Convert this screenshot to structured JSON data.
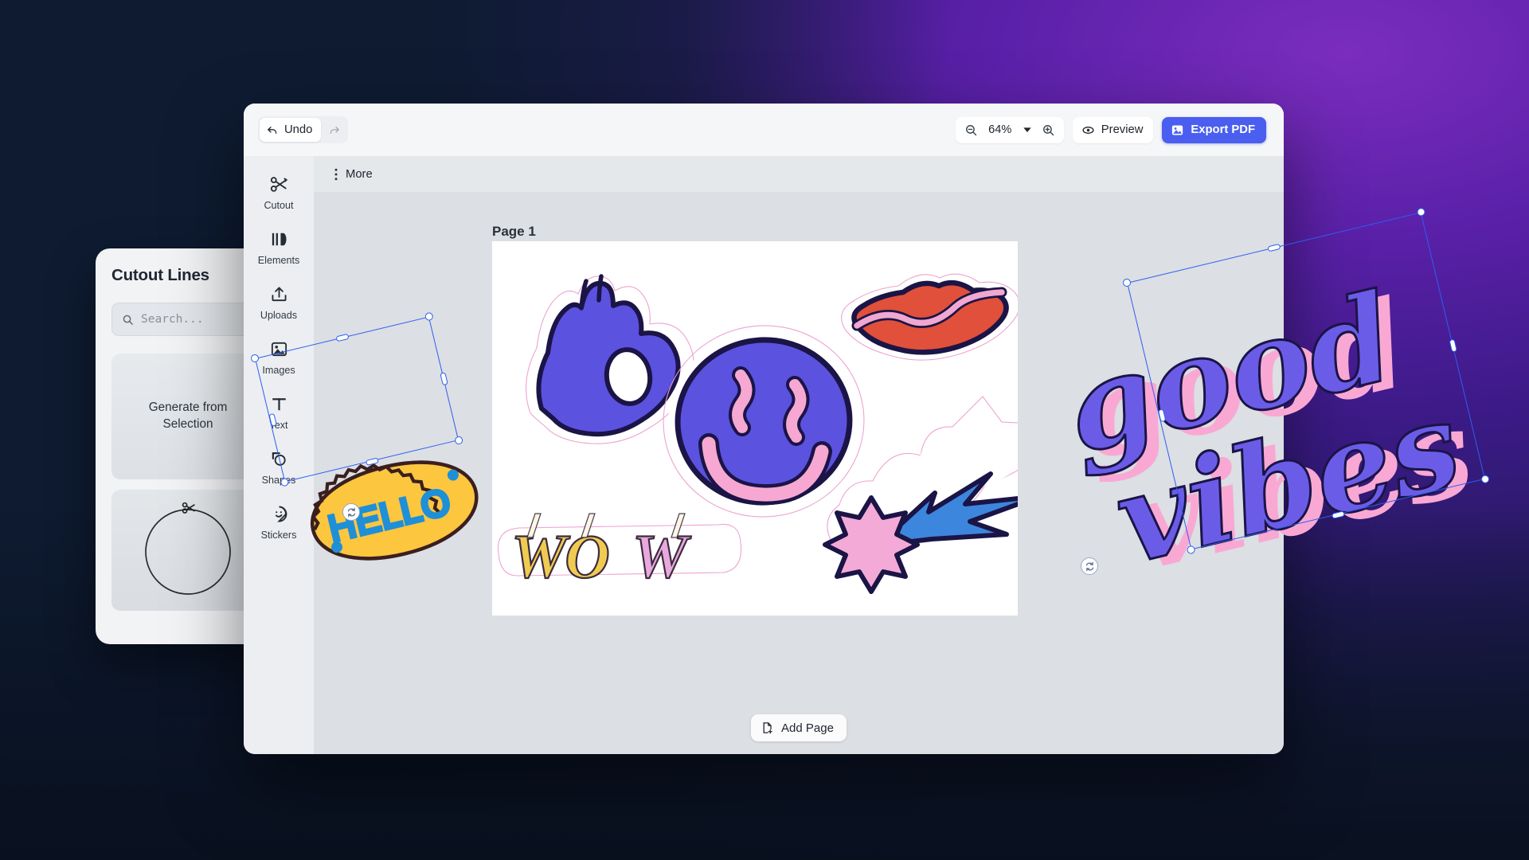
{
  "background": {
    "dark": "#0e1b31",
    "purple": "#5a20a8",
    "magenta": "#7b2dbd"
  },
  "cutout_panel": {
    "title": "Cutout Lines",
    "search_placeholder": "Search...",
    "generate_button": "Generate from Selection",
    "thumbnail_icon": "scissors-circle-icon"
  },
  "toolbar": {
    "undo_label": "Undo",
    "undo_icon": "undo-arrow-icon",
    "redo_icon": "redo-arrow-icon",
    "zoom_out_icon": "zoom-out-icon",
    "zoom_value": "64%",
    "zoom_caret_icon": "chevron-down-icon",
    "zoom_in_icon": "zoom-in-icon",
    "preview_label": "Preview",
    "preview_icon": "eye-icon",
    "export_label": "Export PDF",
    "export_icon": "image-export-icon",
    "accent_color": "#4a5ef0"
  },
  "more_bar": {
    "label": "More",
    "icon": "more-vertical-icon"
  },
  "rail": {
    "items": [
      {
        "label": "Cutout",
        "icon": "scissors-icon"
      },
      {
        "label": "Elements",
        "icon": "elements-icon"
      },
      {
        "label": "Uploads",
        "icon": "upload-icon"
      },
      {
        "label": "Images",
        "icon": "image-icon"
      },
      {
        "label": "Text",
        "icon": "text-t-icon"
      },
      {
        "label": "Shapes",
        "icon": "shapes-icon"
      },
      {
        "label": "Stickers",
        "icon": "sticker-smiley-icon"
      }
    ]
  },
  "canvas": {
    "page_label": "Page 1",
    "add_page_label": "Add Page",
    "add_page_icon": "add-page-icon",
    "stickers": [
      {
        "name": "ok-hand-sticker",
        "fill": "#5b52e0",
        "outline": "#1b1446"
      },
      {
        "name": "smiley-face-sticker",
        "fill": "#5b52e0",
        "feature": "#f6a8d2"
      },
      {
        "name": "lips-sticker",
        "fill": "#e0503a",
        "highlight": "#f0a8d0"
      },
      {
        "name": "shooting-star-sticker",
        "star_fill": "#f4aad6",
        "trail_fill": "#3d86dd"
      },
      {
        "name": "wow-text-sticker",
        "text": "WOW",
        "color_a": "#f0cb51",
        "color_b": "#e9a8de"
      },
      {
        "name": "hello-badge-sticker",
        "text": "HELLO",
        "badge_fill": "#fcc game",
        "text_color": "#1f8fd8"
      }
    ],
    "cutline_color": "#f0a8d0"
  },
  "selections": [
    {
      "name": "hello-badge-selection",
      "rotation": -13.5
    },
    {
      "name": "good-vibes-selection",
      "rotation": -13.5
    }
  ],
  "good_vibes": {
    "line1": "good",
    "line2": "vibes",
    "fill": "#6b5ce8",
    "shadow": "#f9a8d4",
    "stroke": "#1b1446"
  },
  "hello_badge": {
    "text": "HELLO"
  }
}
